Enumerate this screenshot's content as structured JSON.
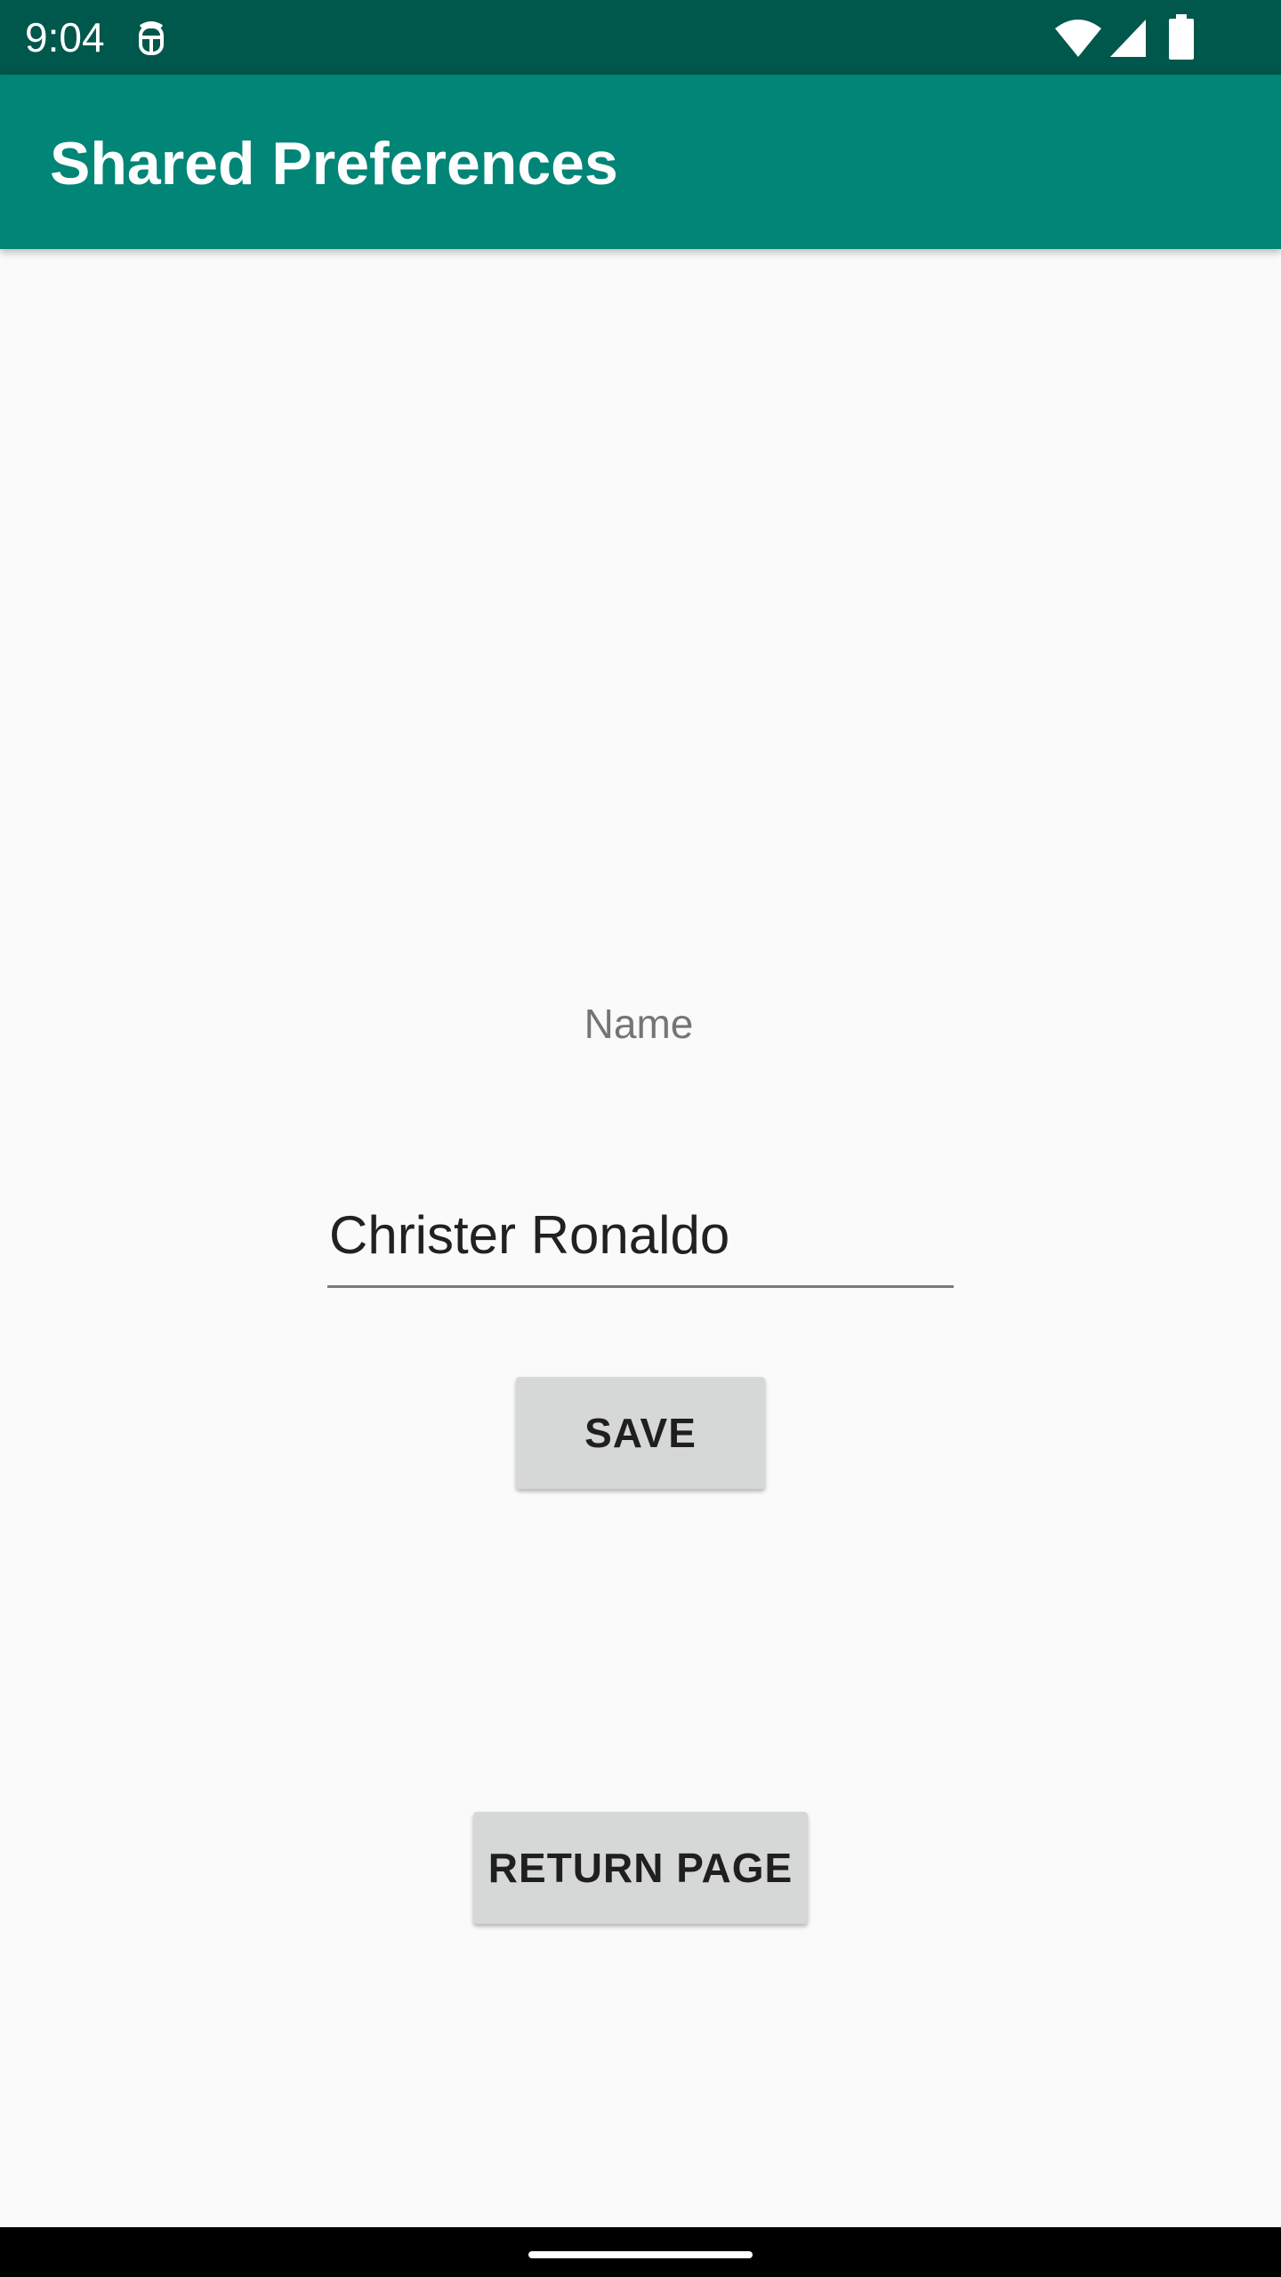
{
  "status_bar": {
    "time": "9:04",
    "icons": [
      "notification-icon",
      "wifi-icon",
      "signal-icon",
      "battery-icon"
    ],
    "background_color": "#00574b"
  },
  "app_bar": {
    "title": "Shared Preferences",
    "background_color": "#008577"
  },
  "form": {
    "name_label": "Name",
    "name_value": "Christer Ronaldo",
    "save_label": "SAVE"
  },
  "footer": {
    "return_label": "RETURN PAGE"
  },
  "colors": {
    "button_background": "#d6d7d7",
    "page_background": "#fafafa"
  }
}
